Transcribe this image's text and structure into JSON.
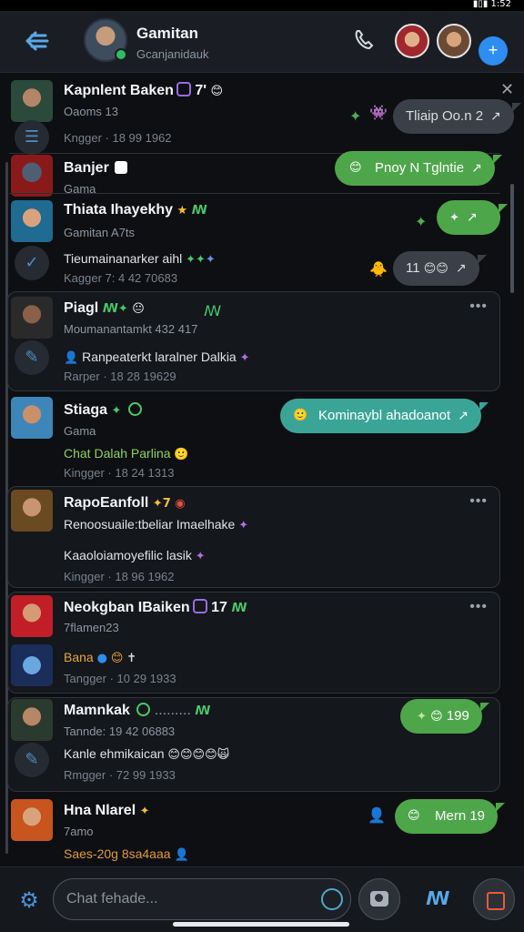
{
  "status_bar": {
    "right_text": "▮▯▮ 1:52"
  },
  "header": {
    "title": "Gamitan",
    "subtitle": "Gcanjanidauk"
  },
  "conversations": [
    {
      "name": "Kapnlent Baken",
      "name_suffix": "7'",
      "sub": "Oaoms 13",
      "time": "Kngger · 18 99 1962",
      "bubble": {
        "text": "Tliaip Oo.n 2",
        "color": "gray"
      }
    },
    {
      "name": "Banjer",
      "sub": "Gama",
      "bubble": {
        "text": "Pnoy N Tglntie",
        "color": "green"
      }
    },
    {
      "name": "Thiata Ihayekhy",
      "sub": "Gamitan A7ts",
      "msg": "Tieumainanarker aihl",
      "time": "Kagger 7: 4 42 70683",
      "bubble": {
        "text": "",
        "color": "green"
      },
      "bubble2": {
        "text": "11",
        "color": "gray"
      }
    },
    {
      "name": "Piagl",
      "sub": "Moumanantamkt 432 417",
      "msg": "Ranpeaterkt laralner Dalkia",
      "time": "Rarper · 18 28 19629"
    },
    {
      "name": "Stiaga",
      "sub": "Gama",
      "msg": "Chat Dalah Parlina",
      "time": "Kingger · 18 24 1313",
      "bubble": {
        "text": "Kominaybl ahadoanot",
        "color": "teal"
      }
    },
    {
      "name": "RapoEanfoll",
      "msg": "Renoosuaile:tbeliar Imaelhake",
      "msg2": "Kaaoloiamoyefilic lasik",
      "time": "Kingger · 18 96 1962"
    },
    {
      "name": "Neokgban IBaiken",
      "name_suffix": "17",
      "sub": "7flamen23",
      "msg": "Bana",
      "time": "Tangger · 10 29 1933"
    },
    {
      "name": "Mamnkak",
      "sub": "Tannde: 19 42 06883",
      "msg": "Kanle ehmikaican",
      "time": "Rmgger · 72 99 1933",
      "bubble": {
        "text": "199",
        "color": "green"
      }
    },
    {
      "name": "Hna Nlarel",
      "sub": "7amo",
      "msg": "Saes-20g 8sa4aaa",
      "bubble": {
        "text": "Mern 19",
        "color": "green"
      }
    }
  ],
  "composer": {
    "placeholder": "Chat fehade..."
  },
  "icons": {
    "back": "back-arrow-icon",
    "phone": "phone-icon",
    "add": "plus-icon",
    "settings": "gear-icon",
    "emoji": "emoji-icon",
    "camera": "camera-icon",
    "sticker": "sticker-icon",
    "record": "record-icon"
  },
  "colors": {
    "accent": "#2e8df0",
    "green_bubble": "#4ea64a",
    "teal_bubble": "#3aa597",
    "gray_bubble": "#3b4048",
    "background": "#0d0f12"
  }
}
